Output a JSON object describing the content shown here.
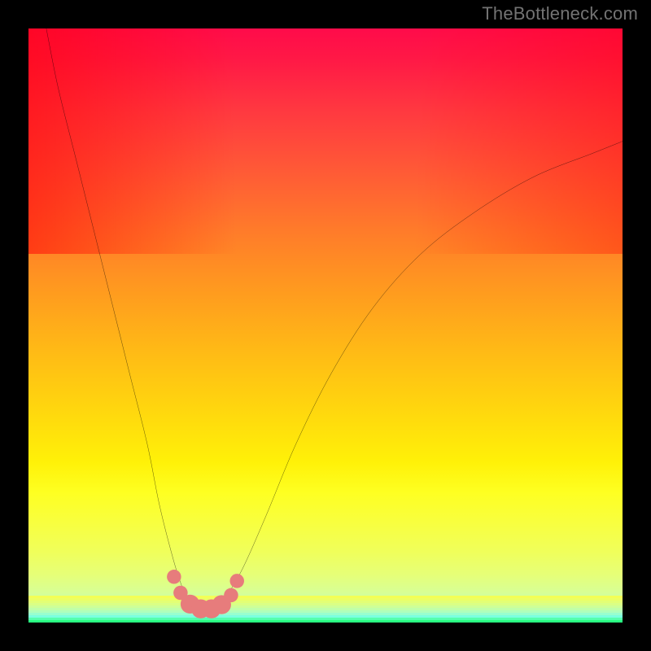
{
  "watermark": "TheBottleneck.com",
  "chart_data": {
    "type": "line",
    "title": "",
    "xlabel": "",
    "ylabel": "",
    "xlim": [
      0,
      100
    ],
    "ylim": [
      0,
      100
    ],
    "gradient_stops": [
      {
        "pos": 0.0,
        "color": "#ff0b4a"
      },
      {
        "pos": 0.14,
        "color": "#ff3940"
      },
      {
        "pos": 0.34,
        "color": "#ff7b2a"
      },
      {
        "pos": 0.54,
        "color": "#ffb916"
      },
      {
        "pos": 0.73,
        "color": "#fff108"
      },
      {
        "pos": 0.88,
        "color": "#f0ff5a"
      },
      {
        "pos": 0.97,
        "color": "#c0ffb6"
      },
      {
        "pos": 1.0,
        "color": "#34ff88"
      }
    ],
    "green_band_colors": [
      "#f3ff56",
      "#ecff64",
      "#e3ff75",
      "#daff85",
      "#ceff97",
      "#c0ffa9",
      "#afffbc",
      "#98ffcf",
      "#7bffdf",
      "#56ffae",
      "#29ff82"
    ],
    "series": [
      {
        "name": "bottleneck-curve",
        "x": [
          3,
          5,
          8,
          11,
          14,
          17,
          20,
          22,
          24,
          25.5,
          27,
          28.5,
          30,
          31.5,
          33,
          36,
          40,
          45,
          51,
          58,
          66,
          75,
          85,
          95,
          100
        ],
        "y": [
          100,
          90,
          78,
          66,
          54,
          42,
          30,
          20,
          12,
          7,
          3.5,
          2.3,
          2.2,
          2.6,
          4,
          9,
          18,
          30,
          42,
          53,
          62,
          69,
          75,
          79,
          81
        ]
      }
    ],
    "markers": [
      {
        "x": 24.5,
        "y": 7.7,
        "r": 1.2
      },
      {
        "x": 25.6,
        "y": 5.0,
        "r": 1.2
      },
      {
        "x": 27.2,
        "y": 3.1,
        "r": 1.6
      },
      {
        "x": 29.0,
        "y": 2.3,
        "r": 1.6
      },
      {
        "x": 30.8,
        "y": 2.3,
        "r": 1.6
      },
      {
        "x": 32.5,
        "y": 3.0,
        "r": 1.6
      },
      {
        "x": 34.1,
        "y": 4.6,
        "r": 1.2
      },
      {
        "x": 35.1,
        "y": 7.0,
        "r": 1.2
      }
    ],
    "marker_color": "#e77c7c",
    "curve_color": "#000000",
    "curve_width": 2.2
  }
}
